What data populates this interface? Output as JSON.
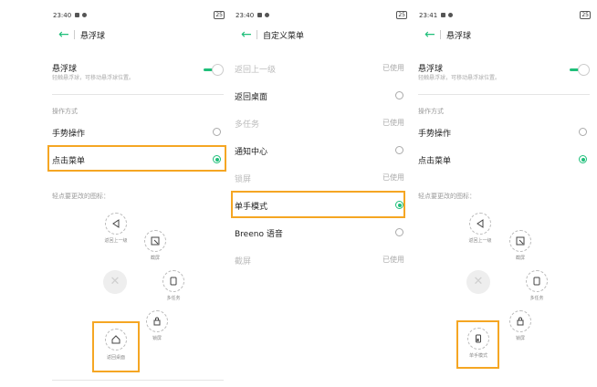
{
  "colors": {
    "accent": "#1fbf7a",
    "highlight": "#f5a623"
  },
  "panel1": {
    "status": {
      "time": "23:40",
      "battery": "25"
    },
    "title": "悬浮球",
    "floatball": {
      "label": "悬浮球",
      "sub": "轻触悬浮球，可移动悬浮球位置。"
    },
    "op_section": "操作方式",
    "options": [
      {
        "label": "手势操作"
      },
      {
        "label": "点击菜单"
      }
    ],
    "hint": "轻点要更改的图标：",
    "bubbles": {
      "back": "返回上一级",
      "screenshot": "截屏",
      "recents": "多任务",
      "lock": "锁屏",
      "home": "返回桌面"
    }
  },
  "panel2": {
    "status": {
      "time": "23:40",
      "battery": "25"
    },
    "title": "自定义菜单",
    "used_label": "已使用",
    "items": [
      {
        "label": "返回上一级",
        "state": "已使用"
      },
      {
        "label": "返回桌面"
      },
      {
        "label": "多任务",
        "state": "已使用"
      },
      {
        "label": "通知中心"
      },
      {
        "label": "锁屏",
        "state": "已使用"
      },
      {
        "label": "单手模式"
      },
      {
        "label": "Breeno 语音"
      },
      {
        "label": "截屏",
        "state": "已使用"
      }
    ]
  },
  "panel3": {
    "status": {
      "time": "23:41",
      "battery": "25"
    },
    "title": "悬浮球",
    "floatball": {
      "label": "悬浮球",
      "sub": "轻触悬浮球，可移动悬浮球位置。"
    },
    "op_section": "操作方式",
    "options": [
      {
        "label": "手势操作"
      },
      {
        "label": "点击菜单"
      }
    ],
    "hint": "轻点要更改的图标：",
    "bubbles": {
      "back": "返回上一级",
      "screenshot": "截屏",
      "recents": "多任务",
      "lock": "锁屏",
      "onehand": "单手模式"
    }
  }
}
